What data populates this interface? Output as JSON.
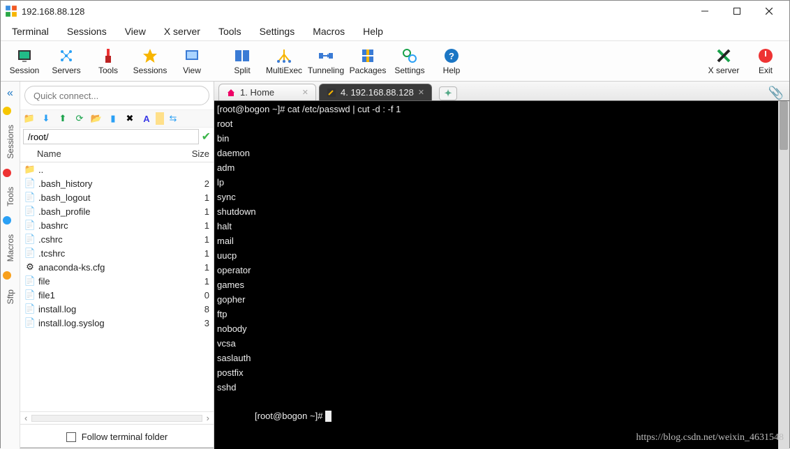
{
  "window": {
    "title": "192.168.88.128"
  },
  "menu": [
    "Terminal",
    "Sessions",
    "View",
    "X server",
    "Tools",
    "Settings",
    "Macros",
    "Help"
  ],
  "toolbar": [
    {
      "label": "Session",
      "icon": "session"
    },
    {
      "label": "Servers",
      "icon": "servers"
    },
    {
      "label": "Tools",
      "icon": "tools"
    },
    {
      "label": "Sessions",
      "icon": "star"
    },
    {
      "label": "View",
      "icon": "view"
    },
    {
      "label": "Split",
      "icon": "split"
    },
    {
      "label": "MultiExec",
      "icon": "multiexec"
    },
    {
      "label": "Tunneling",
      "icon": "tunnel"
    },
    {
      "label": "Packages",
      "icon": "packages"
    },
    {
      "label": "Settings",
      "icon": "gears"
    },
    {
      "label": "Help",
      "icon": "help"
    }
  ],
  "toolbar_right": [
    {
      "label": "X server",
      "icon": "xserver"
    },
    {
      "label": "Exit",
      "icon": "exit"
    }
  ],
  "sidebar_tabs": [
    "Sessions",
    "Tools",
    "Macros",
    "Sftp"
  ],
  "quick_connect_placeholder": "Quick connect...",
  "path": "/root/",
  "file_columns": {
    "name": "Name",
    "size": "Size"
  },
  "files": [
    {
      "name": "..",
      "size": "",
      "type": "up"
    },
    {
      "name": ".bash_history",
      "size": "2",
      "type": "file"
    },
    {
      "name": ".bash_logout",
      "size": "1",
      "type": "file"
    },
    {
      "name": ".bash_profile",
      "size": "1",
      "type": "file"
    },
    {
      "name": ".bashrc",
      "size": "1",
      "type": "file"
    },
    {
      "name": ".cshrc",
      "size": "1",
      "type": "file"
    },
    {
      "name": ".tcshrc",
      "size": "1",
      "type": "file"
    },
    {
      "name": "anaconda-ks.cfg",
      "size": "1",
      "type": "cfg"
    },
    {
      "name": "file",
      "size": "1",
      "type": "file"
    },
    {
      "name": "file1",
      "size": "0",
      "type": "file"
    },
    {
      "name": "install.log",
      "size": "8",
      "type": "file"
    },
    {
      "name": "install.log.syslog",
      "size": "3",
      "type": "file"
    }
  ],
  "follow_label": "Follow terminal folder",
  "tabs": [
    {
      "label": "1. Home",
      "active": false,
      "icon": "home"
    },
    {
      "label": "4. 192.168.88.128",
      "active": true,
      "icon": "wrench"
    }
  ],
  "terminal": {
    "prompt1": "[root@bogon ~]# ",
    "cmd": "cat /etc/passwd | cut -d : -f 1",
    "lines": [
      "root",
      "bin",
      "daemon",
      "adm",
      "lp",
      "sync",
      "shutdown",
      "halt",
      "mail",
      "uucp",
      "operator",
      "games",
      "gopher",
      "ftp",
      "nobody",
      "vcsa",
      "saslauth",
      "postfix",
      "sshd"
    ],
    "prompt2": "[root@bogon ~]# "
  },
  "watermark": "https://blog.csdn.net/weixin_4631548"
}
